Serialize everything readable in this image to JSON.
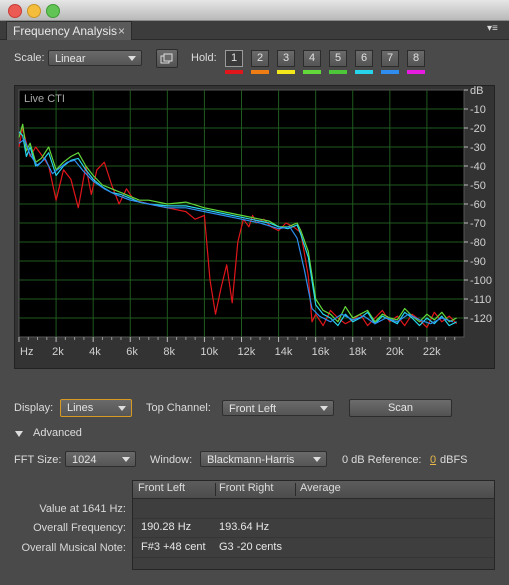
{
  "window": {
    "tab_title": "Frequency Analysis",
    "tab_close": "×",
    "panel_menu": "▾≡"
  },
  "toolbar": {
    "scale_label": "Scale:",
    "scale_value": "Linear",
    "hold_label": "Hold:",
    "hold_buttons": [
      "1",
      "2",
      "3",
      "4",
      "5",
      "6",
      "7",
      "8"
    ],
    "hold_colors": [
      "#e0161b",
      "#f07c14",
      "#f5e81a",
      "#63d83a",
      "#4ec63a",
      "#27d4ec",
      "#2f8df0",
      "#e61ce0"
    ]
  },
  "chart": {
    "overlay_label": "Live CTI",
    "y_unit": "dB",
    "x_unit": "Hz"
  },
  "chart_data": {
    "type": "line",
    "xlabel": "Hz",
    "ylabel": "dB",
    "xlim": [
      0,
      24000
    ],
    "ylim": [
      -130,
      0
    ],
    "x_ticks": [
      "Hz",
      "2k",
      "4k",
      "6k",
      "8k",
      "10k",
      "12k",
      "14k",
      "16k",
      "18k",
      "20k",
      "22k"
    ],
    "y_ticks": [
      "dB",
      "-10",
      "-20",
      "-30",
      "-40",
      "-50",
      "-60",
      "-70",
      "-80",
      "-90",
      "-100",
      "-110",
      "-120"
    ],
    "series": [
      {
        "color": "#e0161b",
        "x": [
          0,
          200,
          400,
          600,
          900,
          1200,
          1600,
          2000,
          2400,
          2800,
          3200,
          3600,
          3900,
          4200,
          4600,
          5000,
          5400,
          5800,
          6200,
          7000,
          8000,
          9000,
          9500,
          10000,
          10300,
          10600,
          10900,
          11200,
          11500,
          11800,
          12100,
          12400,
          12600,
          12800,
          13200,
          13600,
          14000,
          14400,
          14800,
          15200,
          15600,
          15800,
          16000,
          16400,
          16800,
          17200,
          17600,
          18000,
          18400,
          18800,
          19200,
          19600,
          20000,
          20400,
          20800,
          21200,
          21600,
          22000,
          22400,
          22800,
          23200,
          23600
        ],
        "y": [
          -30,
          -20,
          -28,
          -35,
          -30,
          -34,
          -40,
          -58,
          -42,
          -47,
          -62,
          -40,
          -55,
          -42,
          -38,
          -50,
          -60,
          -52,
          -58,
          -60,
          -62,
          -64,
          -68,
          -66,
          -100,
          -118,
          -104,
          -92,
          -112,
          -80,
          -68,
          -72,
          -66,
          -70,
          -68,
          -72,
          -74,
          -70,
          -72,
          -75,
          -98,
          -122,
          -118,
          -124,
          -116,
          -120,
          -123,
          -121,
          -118,
          -124,
          -120,
          -116,
          -122,
          -119,
          -124,
          -118,
          -121,
          -125,
          -117,
          -122,
          -119,
          -123
        ]
      },
      {
        "color": "#63d83a",
        "x": [
          0,
          200,
          400,
          600,
          900,
          1200,
          1600,
          2000,
          2400,
          2800,
          3200,
          3600,
          4000,
          4500,
          5000,
          5500,
          6000,
          6500,
          7000,
          8000,
          9000,
          10000,
          11000,
          12000,
          13000,
          13500,
          14000,
          14500,
          15000,
          15200,
          15600,
          16000,
          16400,
          16800,
          17200,
          17600,
          18000,
          18400,
          18800,
          19200,
          19600,
          20000,
          20400,
          20800,
          21200,
          21600,
          22000,
          22400,
          22800,
          23200,
          23600
        ],
        "y": [
          -25,
          -18,
          -32,
          -28,
          -38,
          -36,
          -30,
          -42,
          -38,
          -35,
          -33,
          -40,
          -45,
          -50,
          -52,
          -54,
          -56,
          -58,
          -58,
          -60,
          -59,
          -62,
          -64,
          -66,
          -68,
          -69,
          -72,
          -72,
          -70,
          -74,
          -85,
          -110,
          -116,
          -118,
          -122,
          -114,
          -120,
          -118,
          -116,
          -122,
          -118,
          -120,
          -121,
          -115,
          -119,
          -122,
          -118,
          -121,
          -117,
          -122,
          -120
        ]
      },
      {
        "color": "#27d4ec",
        "x": [
          0,
          200,
          400,
          600,
          900,
          1200,
          1600,
          2000,
          2400,
          2800,
          3200,
          3600,
          4000,
          4500,
          5000,
          5500,
          6000,
          6500,
          7000,
          8000,
          9000,
          10000,
          11000,
          12000,
          13000,
          13500,
          14000,
          14500,
          15000,
          15200,
          15600,
          16000,
          16400,
          16800,
          17200,
          17600,
          18000,
          18400,
          18800,
          19200,
          19600,
          20000,
          20400,
          20800,
          21200,
          21600,
          22000,
          22400,
          22800,
          23200,
          23600
        ],
        "y": [
          -22,
          -24,
          -35,
          -30,
          -40,
          -38,
          -33,
          -45,
          -40,
          -37,
          -36,
          -42,
          -47,
          -51,
          -54,
          -55,
          -57,
          -59,
          -60,
          -61,
          -61,
          -63,
          -65,
          -67,
          -69,
          -70,
          -72,
          -73,
          -71,
          -76,
          -88,
          -113,
          -118,
          -120,
          -124,
          -118,
          -122,
          -120,
          -117,
          -123,
          -119,
          -121,
          -123,
          -117,
          -120,
          -124,
          -120,
          -123,
          -119,
          -124,
          -122
        ]
      },
      {
        "color": "#2f8df0",
        "x": [
          0,
          300,
          600,
          1000,
          1400,
          1800,
          2200,
          2600,
          3000,
          3500,
          4000,
          4600,
          5200,
          6000,
          7000,
          8000,
          9000,
          10000,
          11000,
          12000,
          13000,
          14000,
          14600,
          15000,
          15400,
          15800,
          16200,
          16800,
          17400,
          18000,
          18600,
          19200,
          19800,
          20400,
          21000,
          21600,
          22200,
          22800,
          23400
        ],
        "y": [
          -28,
          -26,
          -34,
          -40,
          -36,
          -44,
          -41,
          -38,
          -37,
          -43,
          -48,
          -52,
          -55,
          -58,
          -60,
          -62,
          -62,
          -64,
          -66,
          -68,
          -70,
          -73,
          -72,
          -78,
          -95,
          -115,
          -119,
          -122,
          -118,
          -121,
          -119,
          -123,
          -120,
          -122,
          -118,
          -121,
          -123,
          -120,
          -122
        ]
      }
    ]
  },
  "controls": {
    "display_label": "Display:",
    "display_value": "Lines",
    "top_channel_label": "Top Channel:",
    "top_channel_value": "Front Left",
    "scan_label": "Scan",
    "advanced_label": "Advanced",
    "fft_label": "FFT Size:",
    "fft_value": "1024",
    "window_label": "Window:",
    "window_value": "Blackmann-Harris",
    "ref_label": "0 dB Reference:",
    "ref_value": "0",
    "ref_unit": "dBFS"
  },
  "results": {
    "columns": [
      "Front Left",
      "Front Right",
      "Average"
    ],
    "rows": [
      {
        "label": "Value at 1641 Hz:",
        "front_left": "",
        "front_right": "",
        "average": ""
      },
      {
        "label": "Overall Frequency:",
        "front_left": "190.28 Hz",
        "front_right": "193.64 Hz",
        "average": ""
      },
      {
        "label": "Overall Musical Note:",
        "front_left": "F#3 +48 cent",
        "front_right": "G3 -20 cents",
        "average": ""
      }
    ]
  }
}
